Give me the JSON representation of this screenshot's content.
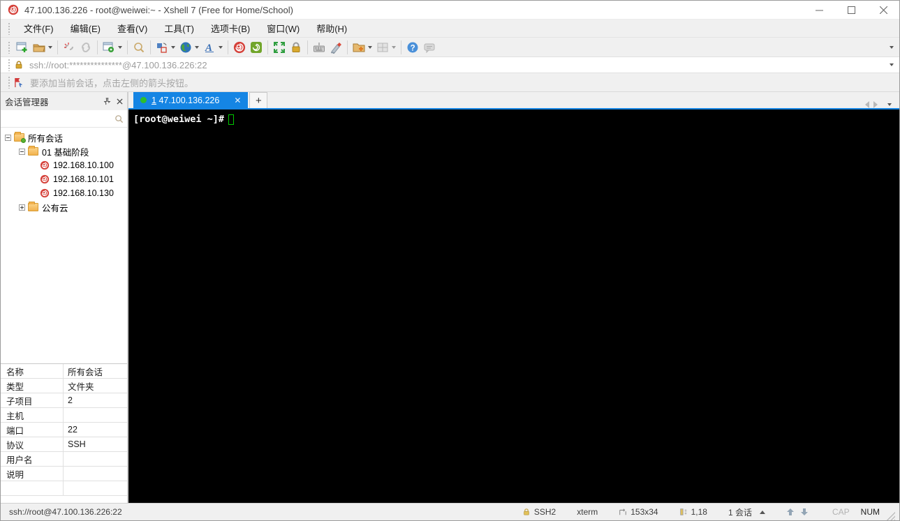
{
  "window": {
    "title": "47.100.136.226 - root@weiwei:~ - Xshell 7 (Free for Home/School)"
  },
  "menu": {
    "items": [
      "文件(F)",
      "编辑(E)",
      "查看(V)",
      "工具(T)",
      "选项卡(B)",
      "窗口(W)",
      "帮助(H)"
    ]
  },
  "toolbar": {
    "icons": [
      "new-session",
      "open-folder",
      "disconnect",
      "reconnect",
      "session-properties",
      "find",
      "arrange-layout",
      "web-browser",
      "font",
      "xshell",
      "xftp",
      "fullscreen",
      "lock-screen",
      "virtual-keyboard",
      "highlighter",
      "new-session-folder",
      "tile-layout",
      "help",
      "feedback"
    ]
  },
  "address_bar": {
    "value": "ssh://root:***************@47.100.136.226:22"
  },
  "info_bar": {
    "message": "要添加当前会话，点击左侧的箭头按钮。"
  },
  "session_manager": {
    "title": "会话管理器",
    "search_value": "",
    "tree": [
      {
        "label": "所有会话",
        "type": "root-folder",
        "expanded": true
      },
      {
        "label": "01 基础阶段",
        "type": "folder",
        "expanded": true
      },
      {
        "label": "192.168.10.100",
        "type": "session"
      },
      {
        "label": "192.168.10.101",
        "type": "session"
      },
      {
        "label": "192.168.10.130",
        "type": "session"
      },
      {
        "label": "公有云",
        "type": "folder",
        "expanded": false
      }
    ],
    "properties": [
      {
        "label": "名称",
        "value": "所有会话"
      },
      {
        "label": "类型",
        "value": "文件夹"
      },
      {
        "label": "子项目",
        "value": "2"
      },
      {
        "label": "主机",
        "value": ""
      },
      {
        "label": "端口",
        "value": "22"
      },
      {
        "label": "协议",
        "value": "SSH"
      },
      {
        "label": "用户名",
        "value": ""
      },
      {
        "label": "说明",
        "value": ""
      }
    ]
  },
  "tabs": {
    "active": {
      "index": "1",
      "label": "47.100.136.226"
    },
    "new_tab_label": "+"
  },
  "terminal": {
    "prompt": "[root@weiwei ~]#"
  },
  "status_bar": {
    "left": "ssh://root@47.100.136.226:22",
    "protocol": "SSH2",
    "term_type": "xterm",
    "size": "153x34",
    "cursor_pos": "1,18",
    "session_count": "1 会话",
    "cap": "CAP",
    "num": "NUM"
  },
  "colors": {
    "accent_blue": "#1585e4",
    "terminal_green": "#00c800",
    "xshell_red": "#d5413a",
    "xftp_green": "#71a52a",
    "folder_tan": "#f2b24e",
    "lock_gold": "#c9a227"
  }
}
